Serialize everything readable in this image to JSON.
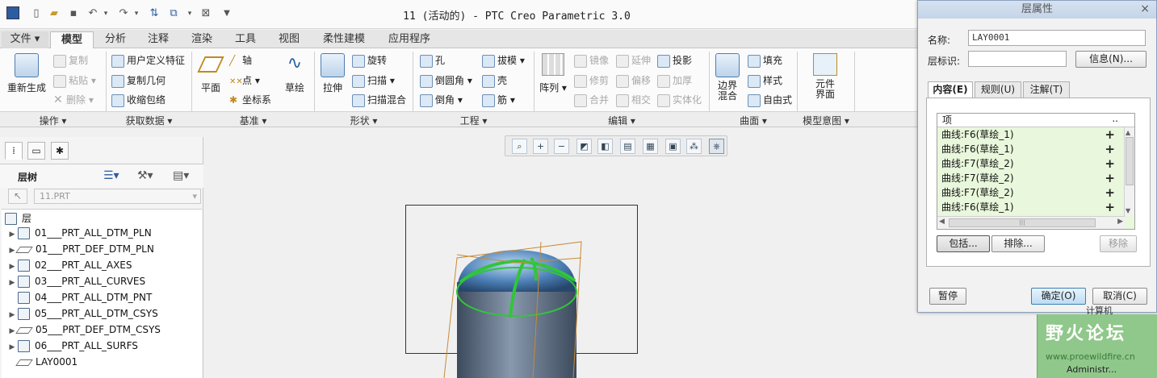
{
  "window": {
    "title": "11 (活动的) - PTC Creo Parametric 3.0"
  },
  "quick_access": [
    "new-icon",
    "open-icon",
    "save-icon",
    "undo-icon",
    "redo-icon",
    "regenerate-icon",
    "windows-icon",
    "close-window-icon",
    "customize-icon"
  ],
  "tabs": [
    {
      "label": "文件",
      "has_arrow": true
    },
    {
      "label": "模型",
      "active": true
    },
    {
      "label": "分析"
    },
    {
      "label": "注释"
    },
    {
      "label": "渲染"
    },
    {
      "label": "工具"
    },
    {
      "label": "视图"
    },
    {
      "label": "柔性建模"
    },
    {
      "label": "应用程序"
    }
  ],
  "ribbon": {
    "operations": {
      "regenerate": "重新生成",
      "copy": "复制",
      "paste": "粘贴",
      "delete": "删除"
    },
    "get_data": {
      "udf": "用户定义特征",
      "copy_geom": "复制几何",
      "shrinkwrap": "收缩包络"
    },
    "datum": {
      "plane": "平面",
      "axis": "轴",
      "point": "点",
      "csys": "坐标系",
      "sketch": "草绘"
    },
    "shapes": {
      "extrude": "拉伸",
      "revolve": "旋转",
      "sweep": "扫描",
      "swept_blend": "扫描混合"
    },
    "engineering": {
      "hole": "孔",
      "round": "倒圆角",
      "chamfer": "倒角",
      "draft": "拔模",
      "shell": "壳",
      "rib": "筋"
    },
    "editing": {
      "pattern": "阵列",
      "mirror": "镜像",
      "trim": "修剪",
      "merge": "合并",
      "extend": "延伸",
      "offset": "偏移",
      "intersect": "相交",
      "project": "投影",
      "thicken": "加厚",
      "solidify": "实体化"
    },
    "surfaces": {
      "boundary_blend_1": "边界",
      "boundary_blend_2": "混合",
      "fill": "填充",
      "style": "样式",
      "freestyle": "自由式"
    },
    "model_intent": {
      "component_interface_1": "元件",
      "component_interface_2": "界面"
    }
  },
  "groups": [
    "操作",
    "获取数据",
    "基准",
    "形状",
    "工程",
    "编辑",
    "曲面",
    "模型意图"
  ],
  "left_panel": {
    "title": "层树",
    "combo_value": "11.PRT",
    "root": "层",
    "layers": [
      {
        "name": "01___PRT_ALL_DTM_PLN",
        "expandable": true,
        "kind": "layer"
      },
      {
        "name": "01___PRT_DEF_DTM_PLN",
        "expandable": true,
        "kind": "plane"
      },
      {
        "name": "02___PRT_ALL_AXES",
        "expandable": true,
        "kind": "layer"
      },
      {
        "name": "03___PRT_ALL_CURVES",
        "expandable": true,
        "kind": "layer"
      },
      {
        "name": "04___PRT_ALL_DTM_PNT",
        "expandable": false,
        "kind": "layer"
      },
      {
        "name": "05___PRT_ALL_DTM_CSYS",
        "expandable": true,
        "kind": "layer"
      },
      {
        "name": "05___PRT_DEF_DTM_CSYS",
        "expandable": true,
        "kind": "plane"
      },
      {
        "name": "06___PRT_ALL_SURFS",
        "expandable": true,
        "kind": "layer"
      },
      {
        "name": "LAY0001",
        "expandable": false,
        "kind": "plane"
      }
    ]
  },
  "dialog": {
    "title": "层属性",
    "name_label": "名称:",
    "name_value": "LAY0001",
    "id_label": "层标识:",
    "id_value": "",
    "info_button": "信息(N)...",
    "tabs": [
      {
        "label": "内容(E)",
        "active": true
      },
      {
        "label": "规则(U)"
      },
      {
        "label": "注解(T)"
      }
    ],
    "list_header": "项",
    "list_header_extra": "..",
    "items": [
      "曲线:F6(草绘_1)",
      "曲线:F6(草绘_1)",
      "曲线:F7(草绘_2)",
      "曲线:F7(草绘_2)",
      "曲线:F7(草绘_2)",
      "曲线:F6(草绘_1)"
    ],
    "include_button": "包括...",
    "exclude_button": "排除...",
    "remove_button": "移除",
    "pause_button": "暂停",
    "ok_button": "确定(O)",
    "cancel_button": "取消(C)"
  },
  "watermark": {
    "text": "野火论坛",
    "url": "www.proewildfire.cn",
    "user": "Administr...",
    "top_text": "计算机"
  },
  "colors": {
    "accent": "#1f5f9f",
    "list_bg": "#e9f7dc",
    "curve_green": "#31c53a",
    "cylinder": "#5a6e86"
  }
}
